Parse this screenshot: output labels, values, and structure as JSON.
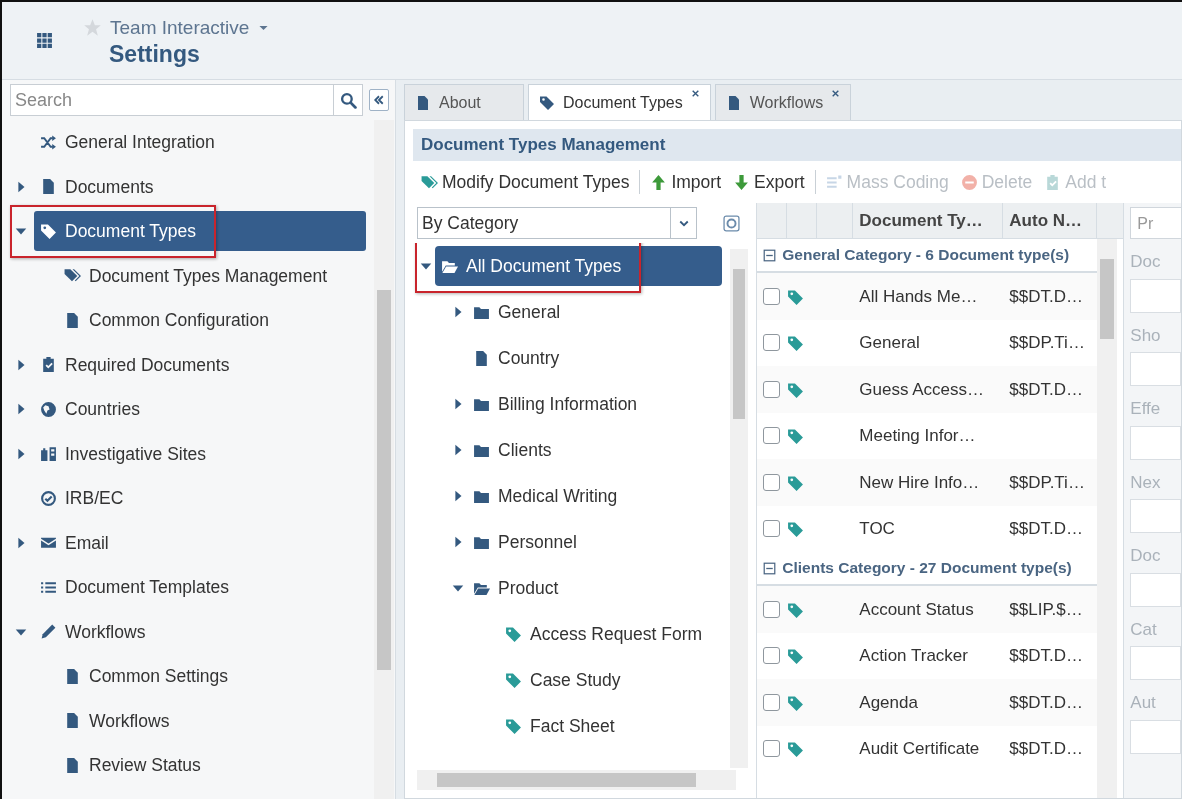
{
  "header": {
    "app_title": "Team Interactive",
    "page_title": "Settings"
  },
  "sidebar": {
    "search_placeholder": "Search",
    "items": [
      {
        "label": "General Integration",
        "kind": "integration",
        "selected": false
      },
      {
        "label": "Documents",
        "kind": "document",
        "expanded": false,
        "selected": false
      },
      {
        "label": "Document Types",
        "kind": "tag",
        "expanded": true,
        "selected": true,
        "highlighted": true,
        "children": [
          {
            "label": "Document Types Management",
            "kind": "tags",
            "selected": false
          },
          {
            "label": "Common Configuration",
            "kind": "document",
            "selected": false
          }
        ]
      },
      {
        "label": "Required Documents",
        "kind": "clipboard",
        "expanded": false,
        "selected": false
      },
      {
        "label": "Countries",
        "kind": "globe",
        "expanded": false,
        "selected": false
      },
      {
        "label": "Investigative Sites",
        "kind": "sites",
        "expanded": false,
        "selected": false
      },
      {
        "label": "IRB/EC",
        "kind": "check",
        "selected": false
      },
      {
        "label": "Email",
        "kind": "email",
        "expanded": false,
        "selected": false
      },
      {
        "label": "Document Templates",
        "kind": "list",
        "selected": false
      },
      {
        "label": "Workflows",
        "kind": "pencil",
        "expanded": true,
        "selected": false,
        "children": [
          {
            "label": "Common Settings",
            "kind": "document",
            "selected": false
          },
          {
            "label": "Workflows",
            "kind": "document",
            "selected": false
          },
          {
            "label": "Review Status",
            "kind": "document",
            "selected": false
          }
        ]
      }
    ]
  },
  "tabs": [
    {
      "label": "About",
      "kind": "document",
      "selected": false,
      "closable": false
    },
    {
      "label": "Document Types",
      "kind": "tag",
      "selected": true,
      "closable": true
    },
    {
      "label": "Workflows",
      "kind": "document",
      "selected": false,
      "closable": true
    }
  ],
  "panel": {
    "title": "Document Types Management",
    "toolbar": [
      {
        "label": "Modify Document Types",
        "kind": "modify",
        "disabled": false
      },
      {
        "kind": "separator"
      },
      {
        "label": "Import",
        "kind": "import",
        "disabled": false
      },
      {
        "label": "Export",
        "kind": "export",
        "disabled": false
      },
      {
        "kind": "separator"
      },
      {
        "label": "Mass Coding",
        "kind": "mass",
        "disabled": true
      },
      {
        "label": "Delete",
        "kind": "delete",
        "disabled": true
      },
      {
        "label": "Add t",
        "kind": "add",
        "disabled": true
      }
    ],
    "tree": {
      "filter": "By Category",
      "items": [
        {
          "label": "All Document Types",
          "kind": "folder",
          "expanded": true,
          "selected": true,
          "highlighted": true,
          "children": [
            {
              "label": "General",
              "kind": "folder",
              "expanded": false,
              "selected": false
            },
            {
              "label": "Country",
              "kind": "document",
              "selected": false
            },
            {
              "label": "Billing Information",
              "kind": "folder",
              "expanded": false,
              "selected": false
            },
            {
              "label": "Clients",
              "kind": "folder",
              "expanded": false,
              "selected": false
            },
            {
              "label": "Medical Writing",
              "kind": "folder",
              "expanded": false,
              "selected": false
            },
            {
              "label": "Personnel",
              "kind": "folder",
              "expanded": false,
              "selected": false
            },
            {
              "label": "Product",
              "kind": "folder",
              "expanded": true,
              "selected": false,
              "children": [
                {
                  "label": "Access Request Form",
                  "kind": "tag",
                  "selected": false
                },
                {
                  "label": "Case Study",
                  "kind": "tag",
                  "selected": false
                },
                {
                  "label": "Fact Sheet",
                  "kind": "tag",
                  "selected": false
                }
              ]
            }
          ]
        }
      ]
    },
    "grid": {
      "columns": [
        {
          "label": "Document Ty…"
        },
        {
          "label": "Auto N…"
        }
      ],
      "groups": [
        {
          "title": "General Category - 6 Document type(s)",
          "expanded": true,
          "rows": [
            {
              "name": "All Hands Me…",
              "auto_number": "$$DT.D…",
              "checked": false
            },
            {
              "name": "General",
              "auto_number": "$$DP.Ti…",
              "checked": false
            },
            {
              "name": "Guess Access…",
              "auto_number": "$$DT.D…",
              "checked": false
            },
            {
              "name": "Meeting Infor…",
              "checked": false
            },
            {
              "name": "New Hire Info…",
              "auto_number": "$$DP.Ti…",
              "checked": false
            },
            {
              "name": "TOC",
              "auto_number": "$$DT.D…",
              "checked": false
            }
          ]
        },
        {
          "title": "Clients Category - 27 Document type(s)",
          "expanded": true,
          "rows": [
            {
              "name": "Account Status",
              "auto_number": "$$LIP.$…",
              "checked": false
            },
            {
              "name": "Action Tracker",
              "auto_number": "$$DT.D…",
              "checked": false
            },
            {
              "name": "Agenda",
              "auto_number": "$$DT.D…",
              "checked": false
            },
            {
              "name": "Audit Certificate",
              "auto_number": "$$DT.D…",
              "checked": false
            }
          ]
        }
      ]
    },
    "properties": {
      "tab": "Pr",
      "fields": [
        {
          "label": "Doc"
        },
        {
          "label": "Sho"
        },
        {
          "label": "Effe"
        },
        {
          "label": "Nex"
        },
        {
          "label": "Doc"
        },
        {
          "label": "Cat"
        },
        {
          "label": "Aut"
        }
      ]
    }
  }
}
